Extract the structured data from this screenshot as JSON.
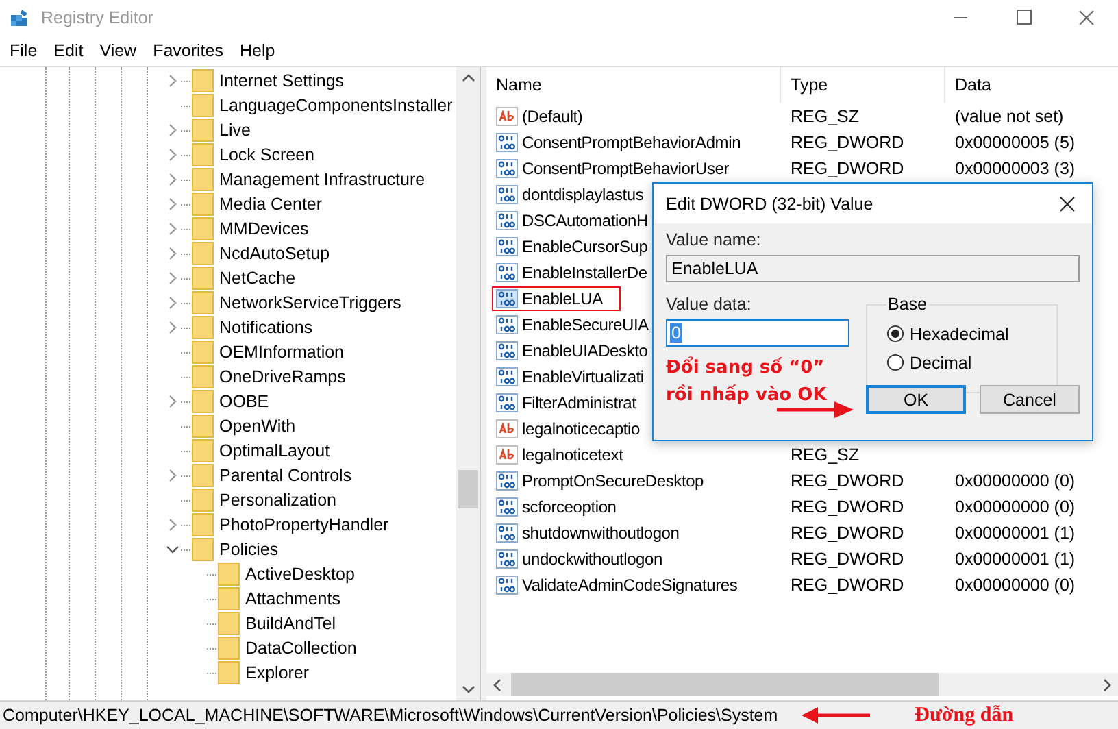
{
  "window": {
    "title": "Registry Editor"
  },
  "menu": [
    "File",
    "Edit",
    "View",
    "Favorites",
    "Help"
  ],
  "tree": [
    {
      "label": "Internet Settings",
      "expandable": true,
      "expanded": false
    },
    {
      "label": "LanguageComponentsInstaller",
      "expandable": false,
      "expanded": false
    },
    {
      "label": "Live",
      "expandable": true,
      "expanded": false
    },
    {
      "label": "Lock Screen",
      "expandable": true,
      "expanded": false
    },
    {
      "label": "Management Infrastructure",
      "expandable": true,
      "expanded": false
    },
    {
      "label": "Media Center",
      "expandable": true,
      "expanded": false
    },
    {
      "label": "MMDevices",
      "expandable": true,
      "expanded": false
    },
    {
      "label": "NcdAutoSetup",
      "expandable": true,
      "expanded": false
    },
    {
      "label": "NetCache",
      "expandable": true,
      "expanded": false
    },
    {
      "label": "NetworkServiceTriggers",
      "expandable": true,
      "expanded": false
    },
    {
      "label": "Notifications",
      "expandable": true,
      "expanded": false
    },
    {
      "label": "OEMInformation",
      "expandable": false,
      "expanded": false
    },
    {
      "label": "OneDriveRamps",
      "expandable": false,
      "expanded": false
    },
    {
      "label": "OOBE",
      "expandable": true,
      "expanded": false
    },
    {
      "label": "OpenWith",
      "expandable": false,
      "expanded": false
    },
    {
      "label": "OptimalLayout",
      "expandable": false,
      "expanded": false
    },
    {
      "label": "Parental Controls",
      "expandable": true,
      "expanded": false
    },
    {
      "label": "Personalization",
      "expandable": false,
      "expanded": false
    },
    {
      "label": "PhotoPropertyHandler",
      "expandable": true,
      "expanded": false
    },
    {
      "label": "Policies",
      "expandable": true,
      "expanded": true,
      "children": [
        {
          "label": "ActiveDesktop",
          "expandable": false,
          "expanded": false
        },
        {
          "label": "Attachments",
          "expandable": false,
          "expanded": false
        },
        {
          "label": "BuildAndTel",
          "expandable": false,
          "expanded": false
        },
        {
          "label": "DataCollection",
          "expandable": false,
          "expanded": false
        },
        {
          "label": "Explorer",
          "expandable": false,
          "expanded": false
        }
      ]
    }
  ],
  "values": {
    "columns": [
      "Name",
      "Type",
      "Data"
    ],
    "rows": [
      {
        "kind": "string",
        "name": "(Default)",
        "type": "REG_SZ",
        "data": "(value not set)",
        "selected": false
      },
      {
        "kind": "dword",
        "name": "ConsentPromptBehaviorAdmin",
        "type": "REG_DWORD",
        "data": "0x00000005 (5)",
        "selected": false
      },
      {
        "kind": "dword",
        "name": "ConsentPromptBehaviorUser",
        "type": "REG_DWORD",
        "data": "0x00000003 (3)",
        "selected": false
      },
      {
        "kind": "dword",
        "name": "dontdisplaylastus",
        "selected": false
      },
      {
        "kind": "dword",
        "name": "DSCAutomationH",
        "selected": false
      },
      {
        "kind": "dword",
        "name": "EnableCursorSup",
        "selected": false
      },
      {
        "kind": "dword",
        "name": "EnableInstallerDe",
        "selected": false
      },
      {
        "kind": "dword",
        "name": "EnableLUA",
        "selected": true
      },
      {
        "kind": "dword",
        "name": "EnableSecureUIA",
        "selected": false
      },
      {
        "kind": "dword",
        "name": "EnableUIADeskto",
        "selected": false
      },
      {
        "kind": "dword",
        "name": "EnableVirtualizati",
        "selected": false
      },
      {
        "kind": "dword",
        "name": "FilterAdministrat",
        "selected": false
      },
      {
        "kind": "string",
        "name": "legalnoticecaptio",
        "selected": false
      },
      {
        "kind": "string",
        "name": "legalnoticetext",
        "type": "REG_SZ",
        "selected": false
      },
      {
        "kind": "dword",
        "name": "PromptOnSecureDesktop",
        "type": "REG_DWORD",
        "data": "0x00000000 (0)",
        "selected": false
      },
      {
        "kind": "dword",
        "name": "scforceoption",
        "type": "REG_DWORD",
        "data": "0x00000000 (0)",
        "selected": false
      },
      {
        "kind": "dword",
        "name": "shutdownwithoutlogon",
        "type": "REG_DWORD",
        "data": "0x00000001 (1)",
        "selected": false
      },
      {
        "kind": "dword",
        "name": "undockwithoutlogon",
        "type": "REG_DWORD",
        "data": "0x00000001 (1)",
        "selected": false
      },
      {
        "kind": "dword",
        "name": "ValidateAdminCodeSignatures",
        "type": "REG_DWORD",
        "data": "0x00000000 (0)",
        "selected": false
      }
    ]
  },
  "dialog": {
    "title": "Edit DWORD (32-bit) Value",
    "value_name_label": "Value name:",
    "value_name": "EnableLUA",
    "value_data_label": "Value data:",
    "value_data": "0",
    "value_data_highlighted": true,
    "base_label": "Base",
    "bases": [
      {
        "label": "Hexadecimal",
        "selected": true
      },
      {
        "label": "Decimal",
        "selected": false
      }
    ],
    "buttons": [
      {
        "label": "OK",
        "default": true
      },
      {
        "label": "Cancel",
        "default": false
      }
    ],
    "note": [
      "Đổi sang số “0”",
      "rồi nhấp vào OK"
    ]
  },
  "status_bar": {
    "path": "Computer\\HKEY_LOCAL_MACHINE\\SOFTWARE\\Microsoft\\Windows\\CurrentVersion\\Policies\\System",
    "note": "Đường dẫn"
  }
}
